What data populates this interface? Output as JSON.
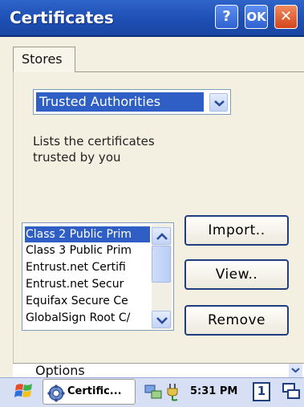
{
  "window": {
    "title": "Certificates",
    "help_label": "?",
    "ok_label": "OK",
    "close_label": "✕"
  },
  "tabs": [
    {
      "label": "Stores",
      "active": true
    }
  ],
  "stores": {
    "selected": "Trusted Authorities",
    "description": "Lists the certificates trusted by you"
  },
  "certificates": {
    "items": [
      "Class 2 Public Prim",
      "Class 3 Public Prim",
      "Entrust.net Certifi",
      "Entrust.net Secur",
      "Equifax Secure Ce",
      "GlobalSign Root C/"
    ],
    "selected_index": 0
  },
  "actions": {
    "import_label": "Import..",
    "view_label": "View..",
    "remove_label": "Remove"
  },
  "strip": {
    "label": "Options"
  },
  "taskbar": {
    "task_label": "Certific...",
    "time": "5:31 PM",
    "desktop_number": "1"
  },
  "colors": {
    "titlebar": "#1d4fb4",
    "selection": "#2f5fc4",
    "button_border": "#1f3e80",
    "dialog_bg": "#f3efe1"
  }
}
